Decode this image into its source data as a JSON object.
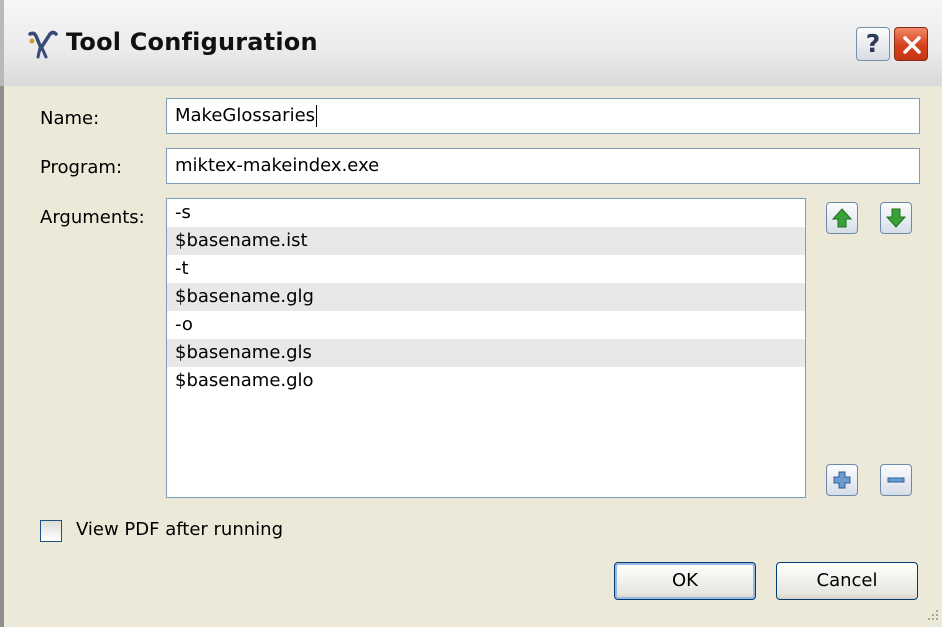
{
  "window": {
    "title": "Tool Configuration"
  },
  "titlebar": {
    "help_label": "?",
    "icons": {
      "app": "texworks-app-icon",
      "close": "close-icon"
    }
  },
  "form": {
    "name_label": "Name:",
    "name_value": "MakeGlossaries",
    "program_label": "Program:",
    "program_value": "miktex-makeindex.exe",
    "arguments_label": "Arguments:",
    "arguments": [
      "-s",
      "$basename.ist",
      "-t",
      "$basename.glg",
      "-o",
      "$basename.gls",
      "$basename.glo"
    ]
  },
  "list_buttons": {
    "up": "arrow-up-icon",
    "down": "arrow-down-icon",
    "add": "plus-icon",
    "remove": "minus-icon"
  },
  "view_pdf": {
    "label": "View PDF after running",
    "checked": false
  },
  "buttons": {
    "ok": "OK",
    "cancel": "Cancel"
  },
  "colors": {
    "accent_green": "#3aa13a",
    "field_border": "#7f9db9",
    "dialog_bg": "#ece9d8",
    "close_red": "#d5401c"
  }
}
